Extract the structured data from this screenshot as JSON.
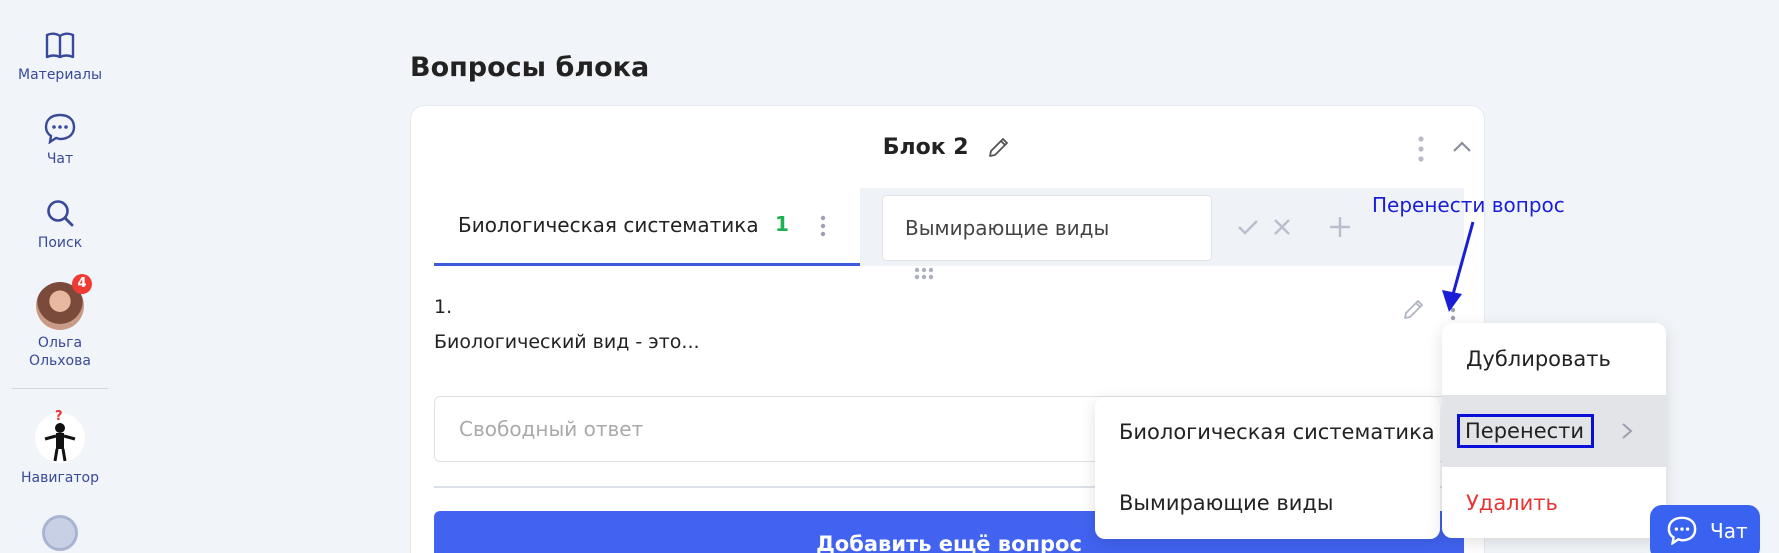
{
  "sidebar": {
    "items": [
      {
        "label": "Материалы",
        "icon": "book-icon"
      },
      {
        "label": "Чат",
        "icon": "chat-bubble-icon"
      },
      {
        "label": "Поиск",
        "icon": "search-icon"
      }
    ],
    "user": {
      "name_line1": "Ольга",
      "name_line2": "Ольхова",
      "badge": "4"
    },
    "navigator": {
      "label": "Навигатор",
      "question_mark": "?"
    }
  },
  "section_title": "Вопросы блока",
  "block": {
    "title": "Блок 2",
    "tabs": [
      {
        "label": "Биологическая систематика",
        "count": "1"
      }
    ],
    "new_tab_value": "Вымирающие виды",
    "question": {
      "number": "1.",
      "text": "Биологический вид - это...",
      "answer_placeholder": "Свободный ответ"
    },
    "add_button": "Добавить ещё вопрос"
  },
  "annotation": "Перенести вопрос",
  "context_menu": {
    "items": [
      "Дублировать",
      "Перенести",
      "Удалить"
    ]
  },
  "submenu": {
    "items": [
      "Биологическая систематика",
      "Вымирающие виды"
    ]
  },
  "chat_button": "Чат",
  "colors": {
    "accent": "#4163f0",
    "success": "#1bb24f",
    "danger": "#e53535",
    "annotation": "#1a1fd6",
    "badge": "#ef3b34"
  }
}
